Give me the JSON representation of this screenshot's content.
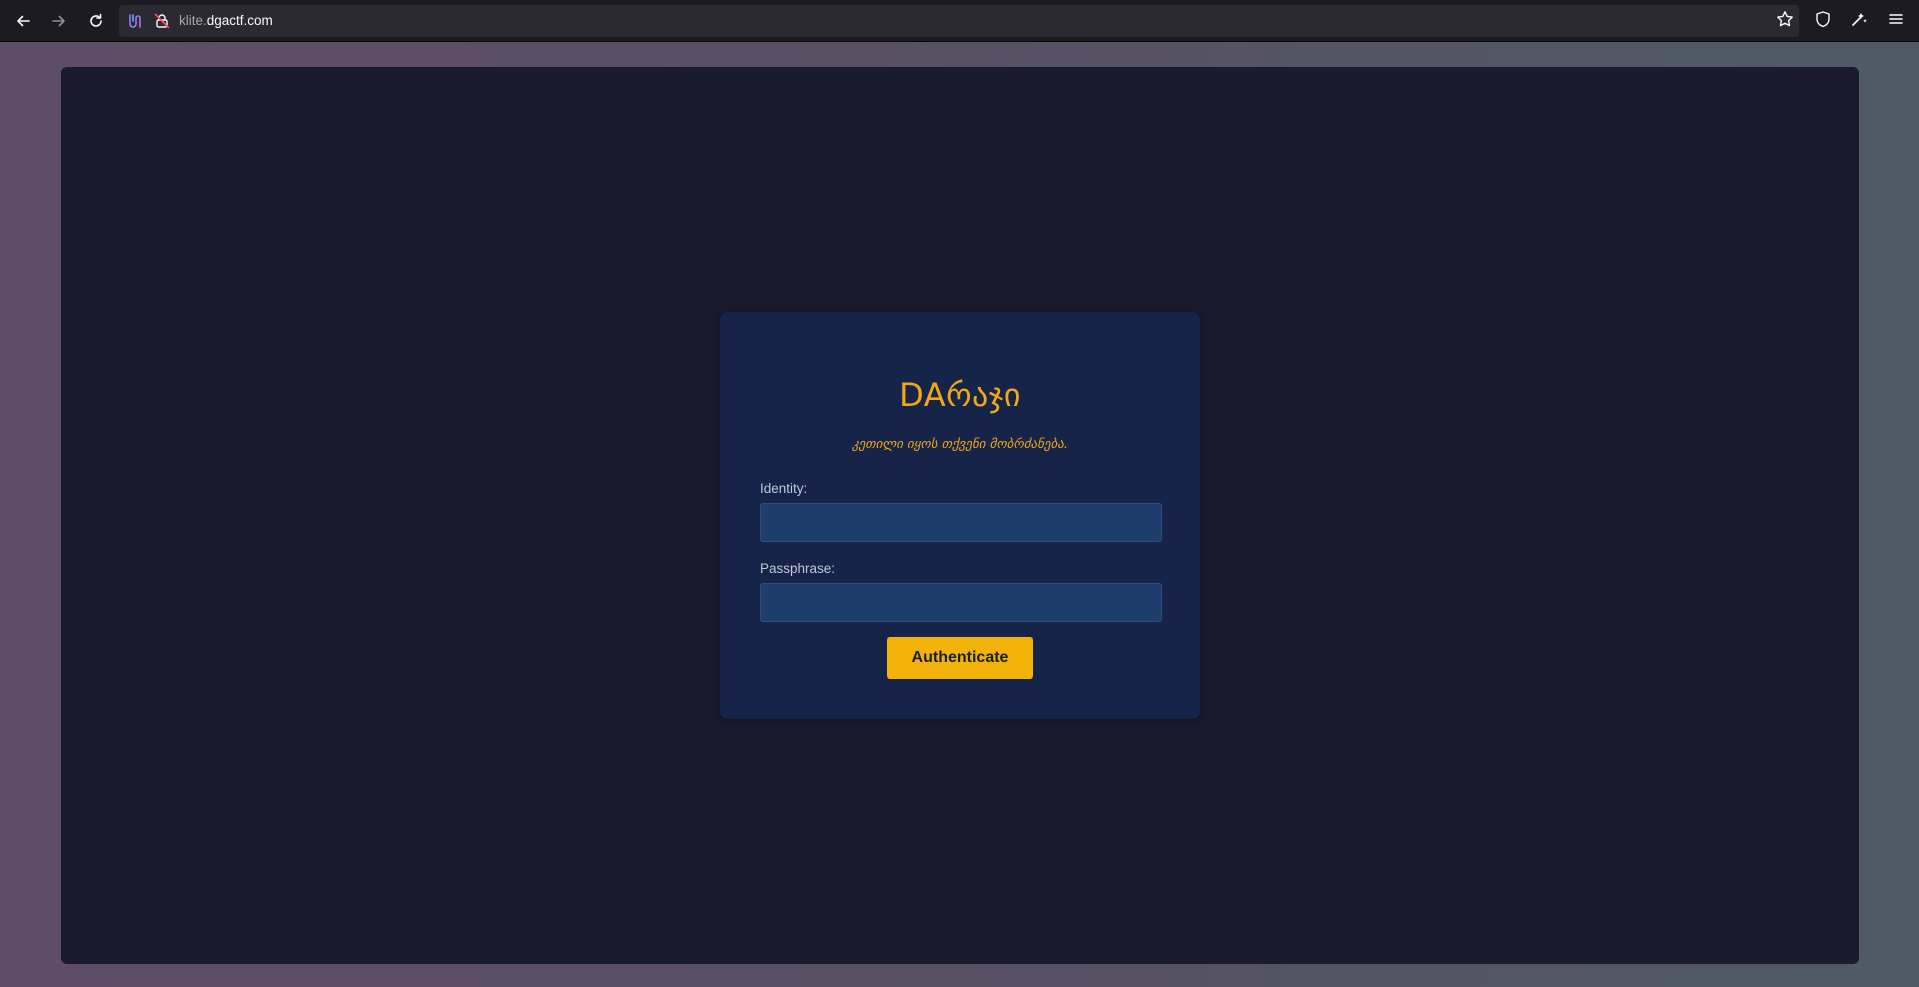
{
  "browser": {
    "url_subdomain": "klite.",
    "url_domain": "dgactf.com",
    "icons": {
      "back": "arrow-left-icon",
      "forward": "arrow-right-icon",
      "reload": "reload-icon",
      "tracking": "tracking-protection-icon",
      "lock": "insecure-lock-icon",
      "bookmark": "star-icon",
      "shield": "shield-icon",
      "extensions": "extension-icon",
      "menu": "hamburger-menu-icon"
    }
  },
  "login": {
    "title": "DAრაჯი",
    "subtitle": "კეთილი იყოს თქვენი მობრძანება.",
    "identity_label": "Identity:",
    "identity_value": "",
    "passphrase_label": "Passphrase:",
    "passphrase_value": "",
    "submit_label": "Authenticate"
  },
  "colors": {
    "accent": "#f0a81a",
    "button": "#f2b20a",
    "card_bg": "#172449",
    "page_bg": "#1b1b2e",
    "input_bg": "#1f3d6b"
  }
}
